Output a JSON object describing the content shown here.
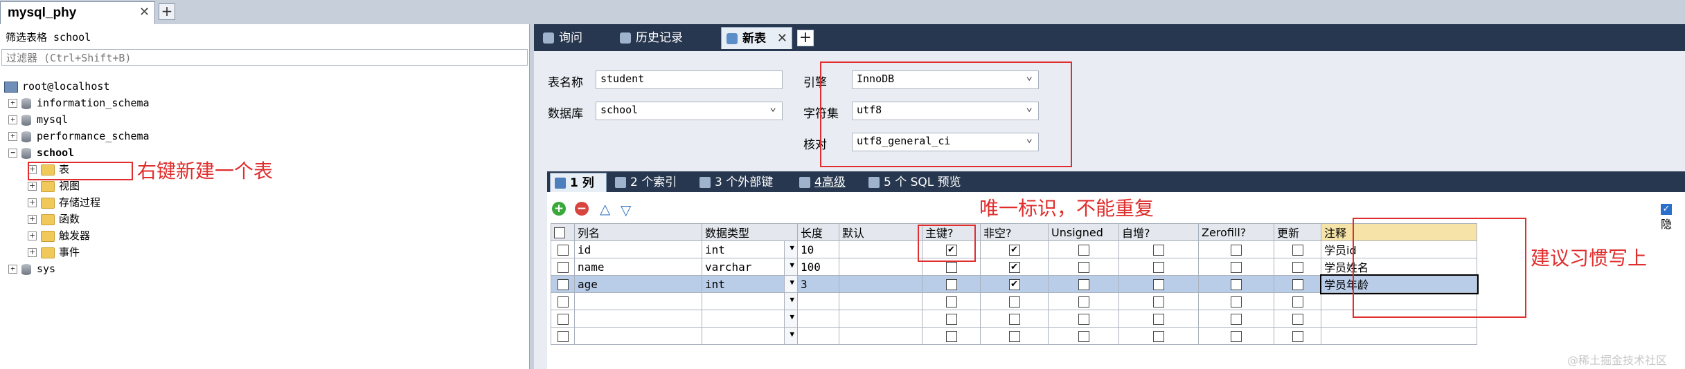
{
  "connection": {
    "tab_label": "mysql_phy",
    "close": "✕",
    "add": "+"
  },
  "left": {
    "filter_label": "筛选表格 school",
    "filter_placeholder": "过滤器 (Ctrl+Shift+B)",
    "host": "root@localhost",
    "databases": [
      "information_schema",
      "mysql",
      "performance_schema",
      "school"
    ],
    "school_children": [
      "表",
      "视图",
      "存储过程",
      "函数",
      "触发器",
      "事件"
    ],
    "sys": "sys"
  },
  "right_tabs": {
    "query": "询问",
    "history": "历史记录",
    "new_table": "新表",
    "close": "✕",
    "add": "+"
  },
  "form": {
    "table_name_label": "表名称",
    "table_name": "student",
    "database_label": "数据库",
    "database": "school",
    "engine_label": "引擎",
    "engine": "InnoDB",
    "charset_label": "字符集",
    "charset": "utf8",
    "collation_label": "核对",
    "collation": "utf8_general_ci"
  },
  "sub_tabs": {
    "columns": "1 列",
    "indexes": "2 个索引",
    "foreign_keys": "3 个外部键",
    "advanced": "4高级",
    "sql_preview": "5 个 SQL 预览"
  },
  "toolbar": {
    "add": "+",
    "remove": "−",
    "up": "△",
    "down": "▽",
    "hide_label": "隐"
  },
  "grid": {
    "headers": [
      "列名",
      "数据类型",
      "长度",
      "默认",
      "主键?",
      "非空?",
      "Unsigned",
      "自增?",
      "Zerofill?",
      "更新",
      "注释"
    ],
    "rows": [
      {
        "name": "id",
        "type": "int",
        "length": "10",
        "pk": true,
        "notnull": true,
        "comment": "学员id"
      },
      {
        "name": "name",
        "type": "varchar",
        "length": "100",
        "pk": false,
        "notnull": true,
        "comment": "学员姓名"
      },
      {
        "name": "age",
        "type": "int",
        "length": "3",
        "pk": false,
        "notnull": true,
        "comment": "学员年龄"
      }
    ],
    "check_mark": "✔"
  },
  "annotations": {
    "right_click": "右键新建一个表",
    "unique": "唯一标识，不能重复",
    "comment_tip": "建议习惯写上",
    "annotation_color": "#e02d2d"
  },
  "watermark": "@稀土掘金技术社区"
}
